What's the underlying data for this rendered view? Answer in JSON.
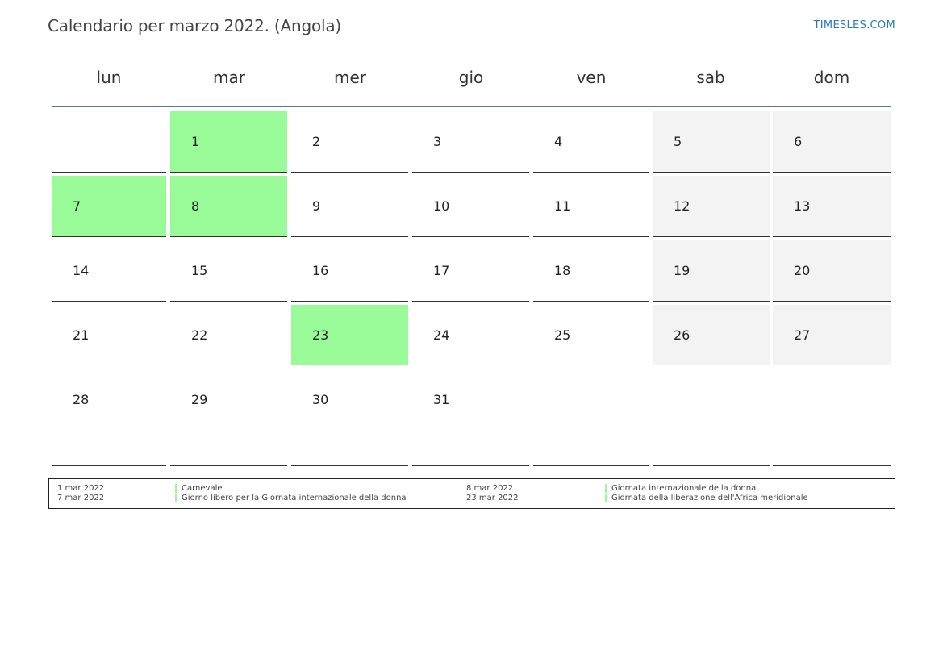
{
  "title": "Calendario per marzo 2022. (Angola)",
  "brand": "TIMESLES.COM",
  "weekdays": [
    "lun",
    "mar",
    "mer",
    "gio",
    "ven",
    "sab",
    "dom"
  ],
  "weeks": [
    [
      "",
      "1",
      "2",
      "3",
      "4",
      "5",
      "6"
    ],
    [
      "7",
      "8",
      "9",
      "10",
      "11",
      "12",
      "13"
    ],
    [
      "14",
      "15",
      "16",
      "17",
      "18",
      "19",
      "20"
    ],
    [
      "21",
      "22",
      "23",
      "24",
      "25",
      "26",
      "27"
    ],
    [
      "28",
      "29",
      "30",
      "31",
      "",
      "",
      ""
    ]
  ],
  "holiday_days": [
    "1",
    "7",
    "8",
    "23"
  ],
  "colors": {
    "holiday": "#98fb98",
    "weekend": "#f3f3f3",
    "header_rule": "#5a7796",
    "brand": "#2a7ab8"
  },
  "holidays": [
    {
      "date": "1 mar 2022",
      "name": "Carnevale"
    },
    {
      "date": "7 mar 2022",
      "name": "Giorno libero per la Giornata internazionale della donna"
    },
    {
      "date": "8 mar 2022",
      "name": "Giornata internazionale della donna"
    },
    {
      "date": "23 mar 2022",
      "name": "Giornata della liberazione dell'Africa meridionale"
    }
  ]
}
